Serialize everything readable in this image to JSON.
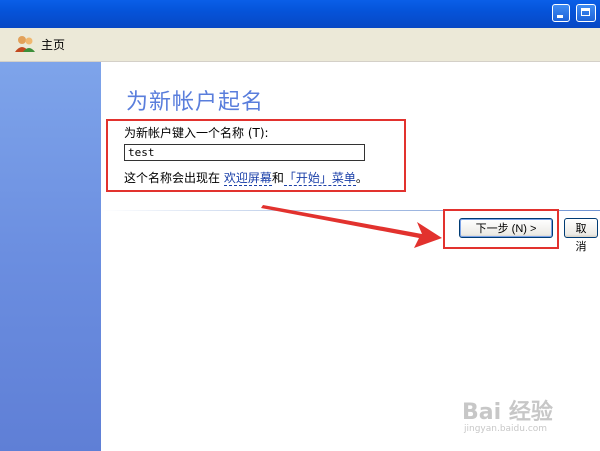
{
  "toolbar": {
    "home_label": "主页",
    "home_icon": "users-icon"
  },
  "titlebar": {
    "minimize_icon": "minimize-icon",
    "maximize_icon": "maximize-icon"
  },
  "wizard": {
    "title": "为新帐户起名",
    "field_label": "为新帐户键入一个名称 (T):",
    "field_value": "test",
    "note_prefix": "这个名称会出现在 ",
    "note_link1": "欢迎屏幕",
    "note_mid": "和",
    "note_link2": "「开始」菜单",
    "note_suffix": "。"
  },
  "buttons": {
    "next": "下一步 (N) >",
    "cancel": "取消"
  },
  "watermark": {
    "logo": "Bai 经验",
    "url": "jingyan.baidu.com"
  },
  "colors": {
    "titlebar": "#0553d9",
    "sidebar": "#6b8ee0",
    "highlight_box": "#e2322e",
    "title_text": "#5a7edc",
    "link": "#1a3fa8"
  }
}
